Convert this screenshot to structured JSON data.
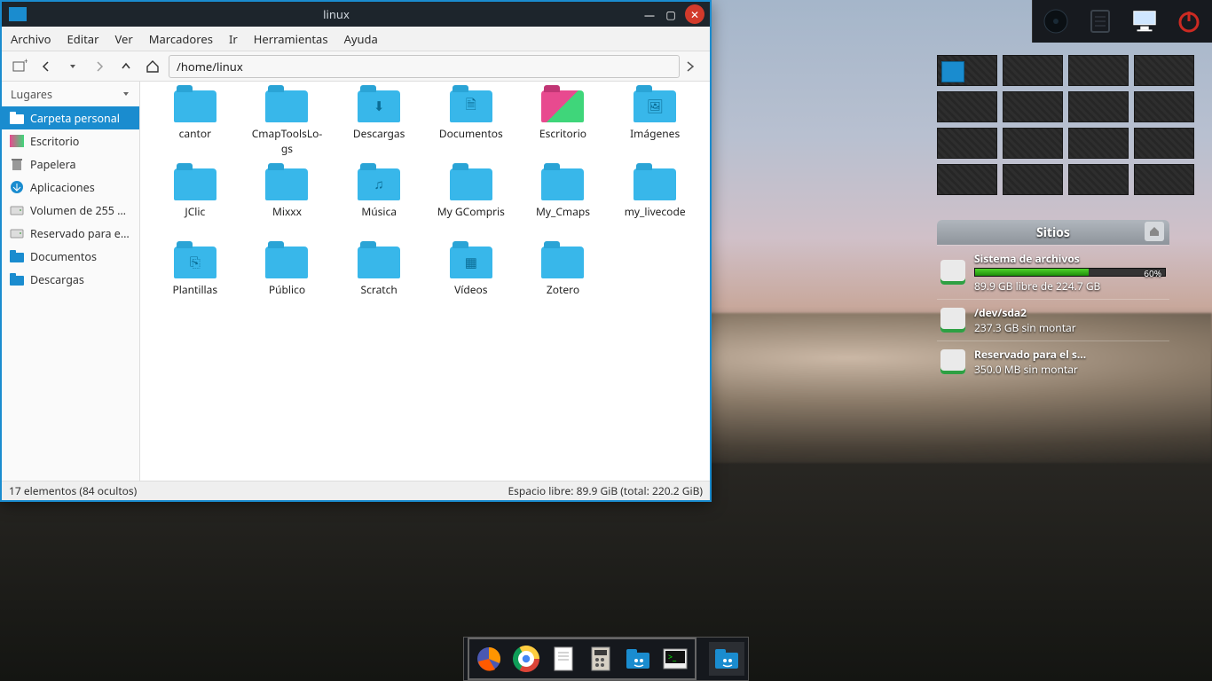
{
  "window": {
    "title": "linux",
    "address": "/home/linux"
  },
  "menubar": [
    "Archivo",
    "Editar",
    "Ver",
    "Marcadores",
    "Ir",
    "Herramientas",
    "Ayuda"
  ],
  "sidebar": {
    "header": "Lugares",
    "items": [
      {
        "label": "Carpeta personal",
        "icon": "folder",
        "selected": true
      },
      {
        "label": "Escritorio",
        "icon": "desktop"
      },
      {
        "label": "Papelera",
        "icon": "trash"
      },
      {
        "label": "Aplicaciones",
        "icon": "apps"
      },
      {
        "label": "Volumen de 255 …",
        "icon": "drive"
      },
      {
        "label": "Reservado para e…",
        "icon": "drive"
      },
      {
        "label": "Documentos",
        "icon": "folder"
      },
      {
        "label": "Descargas",
        "icon": "folder"
      }
    ]
  },
  "folders": [
    {
      "name": "cantor",
      "type": "folder"
    },
    {
      "name": "CmapToolsLo-\ngs",
      "type": "folder"
    },
    {
      "name": "Descargas",
      "type": "dl"
    },
    {
      "name": "Documentos",
      "type": "doc"
    },
    {
      "name": "Escritorio",
      "type": "desk"
    },
    {
      "name": "Imágenes",
      "type": "img"
    },
    {
      "name": "JClic",
      "type": "folder"
    },
    {
      "name": "Mixxx",
      "type": "folder"
    },
    {
      "name": "Música",
      "type": "mus"
    },
    {
      "name": "My GCompris",
      "type": "folder"
    },
    {
      "name": "My_Cmaps",
      "type": "folder"
    },
    {
      "name": "my_livecode",
      "type": "folder"
    },
    {
      "name": "Plantillas",
      "type": "tpl"
    },
    {
      "name": "Público",
      "type": "folder"
    },
    {
      "name": "Scratch",
      "type": "folder"
    },
    {
      "name": "Vídeos",
      "type": "vid"
    },
    {
      "name": "Zotero",
      "type": "folder"
    }
  ],
  "statusbar": {
    "left": "17 elementos (84 ocultos)",
    "right": "Espacio libre: 89.9 GiB (total: 220.2 GiB)"
  },
  "sitios": {
    "title": "Sitios",
    "drives": [
      {
        "title": "Sistema de archivos",
        "pct": "60%",
        "pctw": 60,
        "sub": "89.9 GB libre de 224.7 GB",
        "hasbar": true
      },
      {
        "title": "/dev/sda2",
        "sub": "237.3 GB sin montar",
        "hasbar": false
      },
      {
        "title": "Reservado para el s…",
        "sub": "350.0 MB sin montar",
        "hasbar": false
      }
    ]
  },
  "dock": {
    "launchers": [
      {
        "name": "firefox",
        "bg": "#ff9500"
      },
      {
        "name": "chrome",
        "bg": "#fff"
      },
      {
        "name": "text-editor",
        "bg": "#f4f4f4"
      },
      {
        "name": "calculator",
        "bg": "#d0cbc0"
      },
      {
        "name": "file-manager",
        "bg": "#1a8ccf"
      },
      {
        "name": "terminal",
        "bg": "#e8e8e8"
      }
    ],
    "running": {
      "name": "file-manager",
      "bg": "#1a8ccf"
    }
  }
}
